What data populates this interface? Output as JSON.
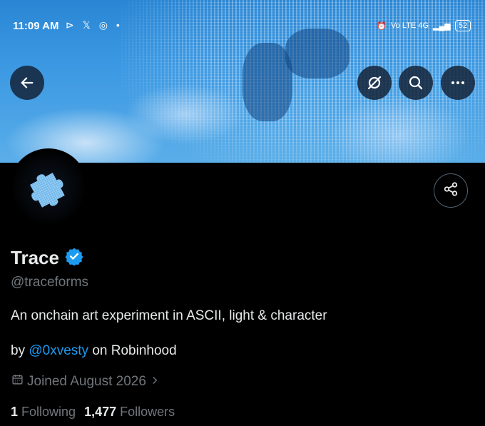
{
  "status_bar": {
    "time": "11:09 AM",
    "app_icons": "⊳ 𝕏 ◎ •",
    "network_label": "Vo LTE 4G",
    "battery": "52"
  },
  "header": {
    "back_icon": "back-arrow-icon",
    "actions": [
      "grok-icon",
      "search-icon",
      "more-icon"
    ]
  },
  "profile": {
    "name": "Trace",
    "verified": true,
    "handle": "@traceforms",
    "bio": "An onchain art experiment in ASCII, light & character",
    "byline_prefix": "by ",
    "byline_link": "@0xvesty",
    "byline_suffix": " on Robinhood",
    "joined": "Joined August 2026",
    "following_count": "1",
    "following_label": "Following",
    "followers_count": "1,477",
    "followers_label": "Followers"
  },
  "colors": {
    "accent": "#1d9bf0",
    "muted": "#71767b",
    "text": "#e7e9ea",
    "background": "#000000"
  }
}
